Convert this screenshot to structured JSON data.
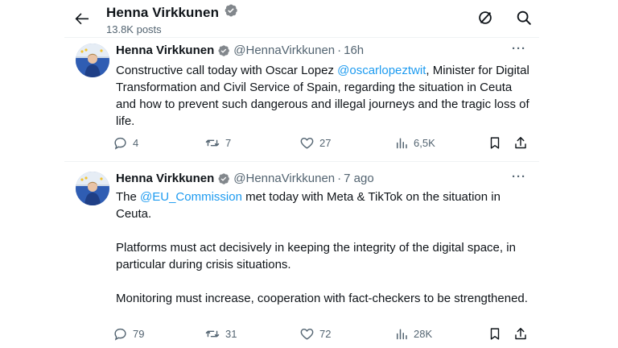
{
  "header": {
    "title": "Henna Virkkunen",
    "subtitle": "13.8K posts",
    "back_icon": "arrow-left-icon",
    "icons": [
      "circle-slash-icon",
      "search-icon"
    ]
  },
  "tweets": [
    {
      "name": "Henna Virkkunen",
      "handle": "@HennaVirkkunen",
      "separator": "·",
      "time": "16h",
      "more": "···",
      "text_parts": [
        "Constructive call today with Oscar Lopez ",
        "@oscarlopeztwit",
        ", Minister for Digital Transformation and Civil Service of Spain, regarding the situation in Ceuta and how to prevent such dangerous and illegal journeys and the tragic loss of life."
      ],
      "stats": {
        "replies": "4",
        "reposts": "7",
        "likes": "27",
        "views": "6,5K"
      }
    },
    {
      "name": "Henna Virkkunen",
      "handle": "@HennaVirkkunen",
      "separator": "·",
      "time": "7 ago",
      "more": "···",
      "text_parts": [
        "The ",
        "@EU_Commission",
        " met today with Meta & TikTok on the situation in Ceuta."
      ],
      "paragraph2": "Platforms must act decisively in keeping the integrity of the digital space, in particular during crisis situations.",
      "paragraph3": "Monitoring must increase, cooperation with fact-checkers to be strengthened.",
      "stats": {
        "replies": "79",
        "reposts": "31",
        "likes": "72",
        "views": "28K"
      }
    }
  ],
  "colors": {
    "accent": "#1d9bf0",
    "muted": "#536471",
    "text": "#0f1419"
  }
}
